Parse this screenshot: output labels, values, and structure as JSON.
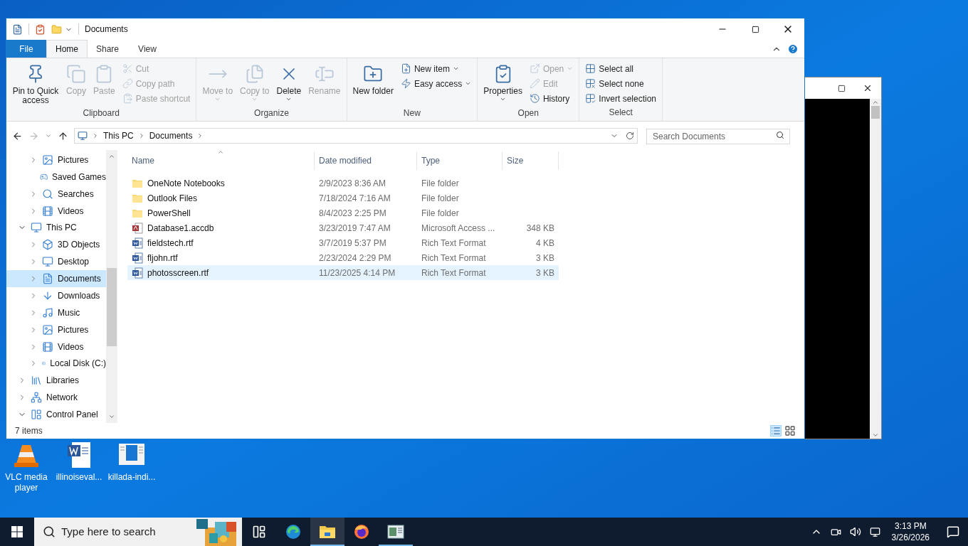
{
  "window": {
    "title": "Documents"
  },
  "ribbon": {
    "tabs": [
      {
        "label": "File",
        "kind": "menu",
        "selected": false
      },
      {
        "label": "Home",
        "kind": "tab",
        "selected": true
      },
      {
        "label": "Share",
        "kind": "tab",
        "selected": false
      },
      {
        "label": "View",
        "kind": "tab",
        "selected": false
      }
    ],
    "groups": [
      {
        "label": "Clipboard",
        "buttons": [
          {
            "label": "Pin to Quick access",
            "kind": "large",
            "disabled": false,
            "dropdown": false
          },
          {
            "label": "Copy",
            "kind": "large",
            "disabled": true,
            "dropdown": false
          },
          {
            "label": "Paste",
            "kind": "large",
            "disabled": true,
            "dropdown": false
          },
          {
            "label": "Cut",
            "kind": "small",
            "disabled": true,
            "dropdown": false
          },
          {
            "label": "Copy path",
            "kind": "small",
            "disabled": true,
            "dropdown": false
          },
          {
            "label": "Paste shortcut",
            "kind": "small",
            "disabled": true,
            "dropdown": false
          }
        ]
      },
      {
        "label": "Organize",
        "buttons": [
          {
            "label": "Move to",
            "kind": "large",
            "disabled": true,
            "dropdown": true
          },
          {
            "label": "Copy to",
            "kind": "large",
            "disabled": true,
            "dropdown": true
          },
          {
            "label": "Delete",
            "kind": "large",
            "disabled": false,
            "dropdown": true
          },
          {
            "label": "Rename",
            "kind": "large",
            "disabled": true,
            "dropdown": false
          }
        ]
      },
      {
        "label": "New",
        "buttons": [
          {
            "label": "New folder",
            "kind": "large",
            "disabled": false,
            "dropdown": false
          },
          {
            "label": "New item",
            "kind": "small",
            "disabled": false,
            "dropdown": true
          },
          {
            "label": "Easy access",
            "kind": "small",
            "disabled": false,
            "dropdown": true
          }
        ]
      },
      {
        "label": "Open",
        "buttons": [
          {
            "label": "Properties",
            "kind": "large",
            "disabled": false,
            "dropdown": true
          },
          {
            "label": "Open",
            "kind": "small",
            "disabled": true,
            "dropdown": true
          },
          {
            "label": "Edit",
            "kind": "small",
            "disabled": true,
            "dropdown": false
          },
          {
            "label": "History",
            "kind": "small",
            "disabled": false,
            "dropdown": false
          }
        ]
      },
      {
        "label": "Select",
        "buttons": [
          {
            "label": "Select all",
            "kind": "small",
            "disabled": false,
            "dropdown": false
          },
          {
            "label": "Select none",
            "kind": "small",
            "disabled": false,
            "dropdown": false
          },
          {
            "label": "Invert selection",
            "kind": "small",
            "disabled": false,
            "dropdown": false
          }
        ]
      }
    ]
  },
  "address": {
    "breadcrumb": [
      "This PC",
      "Documents"
    ]
  },
  "search": {
    "placeholder": "Search Documents"
  },
  "nav": {
    "items": [
      {
        "children": [
          {
            "label": "Pictures",
            "expandable": true,
            "expanded": false,
            "selected": false
          },
          {
            "label": "Saved Games",
            "expandable": false,
            "selected": false
          },
          {
            "label": "Searches",
            "expandable": true,
            "expanded": false,
            "selected": false
          },
          {
            "label": "Videos",
            "expandable": true,
            "expanded": false,
            "selected": false
          }
        ]
      },
      {
        "label": "This PC",
        "expandable": true,
        "expanded": true,
        "selected": false,
        "children": [
          {
            "label": "3D Objects",
            "expandable": true,
            "expanded": false,
            "selected": false
          },
          {
            "label": "Desktop",
            "expandable": true,
            "expanded": false,
            "selected": false
          },
          {
            "label": "Documents",
            "expandable": true,
            "expanded": false,
            "selected": true
          },
          {
            "label": "Downloads",
            "expandable": true,
            "expanded": false,
            "selected": false
          },
          {
            "label": "Music",
            "expandable": true,
            "expanded": false,
            "selected": false
          },
          {
            "label": "Pictures",
            "expandable": true,
            "expanded": false,
            "selected": false
          },
          {
            "label": "Videos",
            "expandable": true,
            "expanded": false,
            "selected": false
          },
          {
            "label": "Local Disk (C:)",
            "expandable": true,
            "expanded": false,
            "selected": false
          }
        ]
      },
      {
        "label": "Libraries",
        "expandable": true,
        "expanded": false,
        "selected": false
      },
      {
        "label": "Network",
        "expandable": true,
        "expanded": false,
        "selected": false
      },
      {
        "label": "Control Panel",
        "expandable": true,
        "expanded": true,
        "selected": false
      }
    ]
  },
  "file_list": {
    "columns": [
      {
        "label": "Name",
        "sorted": true
      },
      {
        "label": "Date modified",
        "sorted": false
      },
      {
        "label": "Type",
        "sorted": false
      },
      {
        "label": "Size",
        "sorted": false
      }
    ],
    "rows": [
      {
        "name": "OneNote Notebooks",
        "date": "2/9/2023 8:36 AM",
        "type": "File folder",
        "kind": "folder",
        "selected": false
      },
      {
        "name": "Outlook Files",
        "date": "7/18/2024 7:16 AM",
        "type": "File folder",
        "kind": "folder",
        "selected": false
      },
      {
        "name": "PowerShell",
        "date": "8/4/2023 2:25 PM",
        "type": "File folder",
        "kind": "folder",
        "selected": false
      },
      {
        "name": "Database1.accdb",
        "date": "3/23/2019 7:47 AM",
        "type": "Microsoft Access ...",
        "size": "348 KB",
        "kind": "database",
        "selected": false
      },
      {
        "name": "fieldstech.rtf",
        "date": "3/7/2019 5:37 PM",
        "type": "Rich Text Format",
        "size": "4 KB",
        "kind": "document",
        "selected": false
      },
      {
        "name": "fljohn.rtf",
        "date": "2/23/2024 2:29 PM",
        "type": "Rich Text Format",
        "size": "3 KB",
        "kind": "document",
        "selected": false
      },
      {
        "name": "photosscreen.rtf",
        "date": "11/23/2025 4:14 PM",
        "type": "Rich Text Format",
        "size": "3 KB",
        "kind": "document",
        "selected": true
      }
    ]
  },
  "status_bar": {
    "text": "7 items"
  },
  "desktop": {
    "icons": [
      {
        "label": "VLC media player",
        "kind": "cone"
      },
      {
        "label": "illinoiseval...",
        "kind": "document"
      },
      {
        "label": "killada-indi...",
        "kind": "page"
      }
    ]
  },
  "taskbar": {
    "search": {
      "placeholder": "Type here to search"
    },
    "apps": [
      {
        "kind": "taskview",
        "selected": false,
        "running": false
      },
      {
        "kind": "browser",
        "selected": false,
        "running": false
      },
      {
        "kind": "folder",
        "selected": true,
        "running": true
      },
      {
        "kind": "firefox",
        "selected": false,
        "running": false
      },
      {
        "kind": "window",
        "selected": false,
        "running": true
      }
    ],
    "clock": {
      "time": "3:13 PM",
      "date": "3/26/2026"
    }
  }
}
